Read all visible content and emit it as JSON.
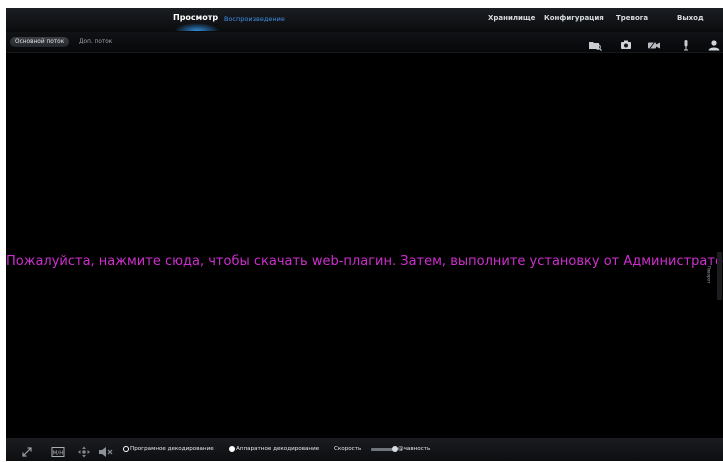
{
  "nav": {
    "preview": "Просмотр",
    "playback": "Воспроизведение",
    "storage": "Хранилище",
    "config": "Конфигурация",
    "alarm": "Тревога",
    "exit": "Выход"
  },
  "stream_tabs": {
    "main": "Основной поток",
    "sub": "Доп. поток"
  },
  "toolbar_icons": [
    "folder-search-icon",
    "camera-snapshot-icon",
    "record-icon",
    "microphone-icon",
    "user-icon"
  ],
  "video": {
    "plugin_message": "Пожалуйста, нажмите сюда, чтобы скачать web-плагин. Затем, выполните установку от Администратора",
    "side_tab_label": "Поворот"
  },
  "bottom": {
    "icons": [
      "fullscreen-icon",
      "layout-icon",
      "ptz-icon",
      "mute-icon"
    ],
    "software_decoding": "Програмное декодирование",
    "hardware_decoding": "Аппаратное декодирование",
    "selected_decoding": "hardware",
    "speed_label": "Скорость",
    "quality_label": "@чавность"
  },
  "colors": {
    "message": "#cf2fcf",
    "active_tab_glow": "#37a5ff",
    "playback_link": "#3f8fe6"
  }
}
